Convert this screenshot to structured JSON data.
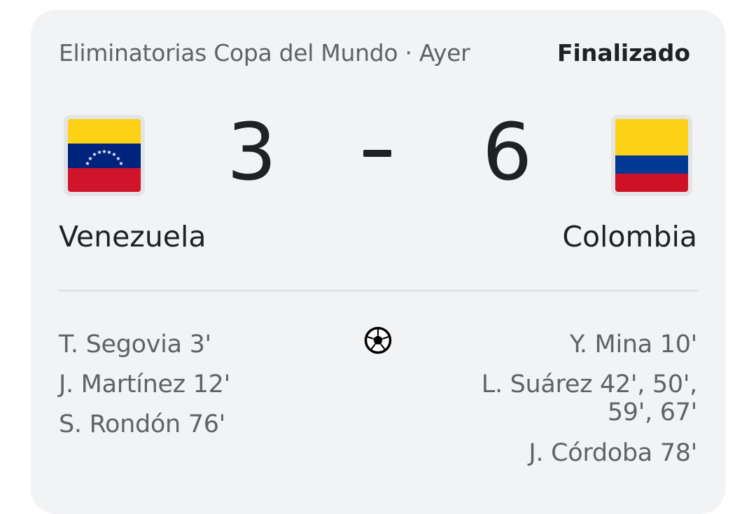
{
  "header": {
    "league": "Eliminatorias Copa del Mundo · Ayer",
    "status": "Finalizado"
  },
  "match": {
    "home": {
      "name": "Venezuela",
      "score": "3",
      "flag_icon": "venezuela-flag-icon",
      "flag_colors": [
        "#fcd116",
        "#00247d",
        "#cf142b"
      ]
    },
    "separator": "-",
    "away": {
      "name": "Colombia",
      "score": "6",
      "flag_icon": "colombia-flag-icon",
      "flag_colors": [
        "#fcd116",
        "#003893",
        "#ce1126"
      ]
    }
  },
  "goals_icon": "soccer-ball-icon",
  "scorers": {
    "home": [
      "T. Segovia 3'",
      "J. Martínez 12'",
      "S. Rondón 76'"
    ],
    "away": [
      "Y. Mina 10'",
      "L. Suárez 42', 50', 59', 67'",
      "J. Córdoba 78'"
    ]
  }
}
